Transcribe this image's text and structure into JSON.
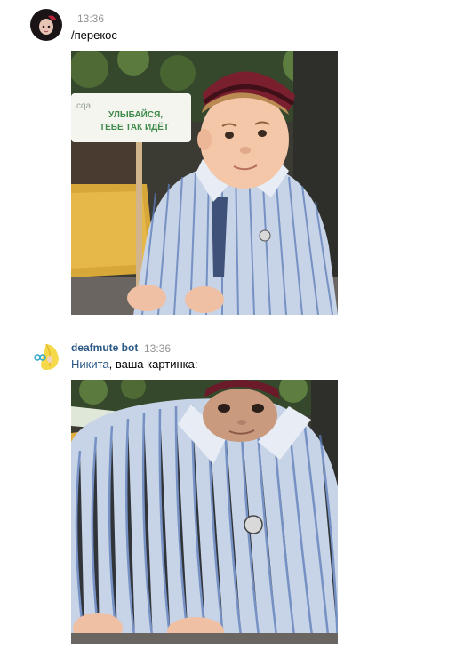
{
  "messages": [
    {
      "author": "",
      "time": "13:36",
      "text": "/перекос",
      "avatar_icon": "user-avatar-icon"
    },
    {
      "author": "deafmute bot",
      "time": "13:36",
      "mention": "Никита",
      "text_rest": ", ваша картинка:",
      "avatar_icon": "bot-avatar-icon"
    }
  ],
  "photo1": {
    "sign_line1": "УЛЫБАЙСЯ,",
    "sign_line2": "ТЕБЕ ТАК ИДЁТ",
    "sign_logo": "cqa"
  },
  "colors": {
    "link": "#2a5885",
    "time": "#939393",
    "sign_text": "#3d8a4a"
  }
}
